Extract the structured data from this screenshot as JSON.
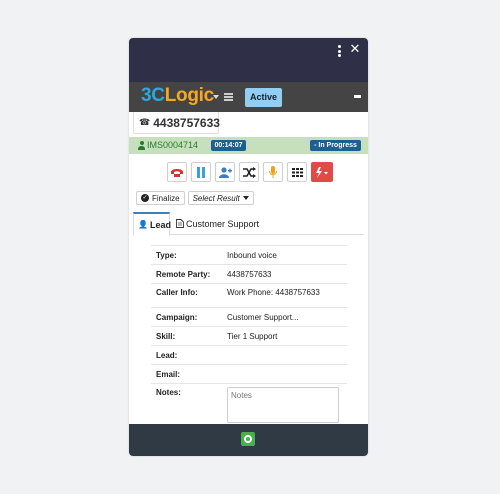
{
  "window": {
    "menu_icon": "kebab-menu-icon",
    "close_icon": "close-icon",
    "close_glyph": "✕"
  },
  "brand": {
    "logo_part1": "3C",
    "logo_part2": "Logic",
    "status_button": "Active"
  },
  "call": {
    "phone_number": "4438757633",
    "interaction_id": "IMS0004714",
    "timer": "00:14:07",
    "status": "- In Progress"
  },
  "controls": {
    "finalize_label": "Finalize",
    "select_result_label": "Select Result",
    "action_icons": [
      "hangup-icon",
      "hold-icon",
      "add-party-icon",
      "transfer-icon",
      "mute-microphone-icon",
      "keypad-icon",
      "alert-dropdown-icon"
    ]
  },
  "tabs": {
    "lead": "Lead",
    "support": "Customer Support"
  },
  "details": [
    {
      "label": "Type:",
      "value": "Inbound voice"
    },
    {
      "label": "Remote Party:",
      "value": "4438757633"
    },
    {
      "label": "Caller Info:",
      "value": "Work Phone: 4438757633"
    },
    {
      "label": "Campaign:",
      "value": "Customer Support..."
    },
    {
      "label": "Skill:",
      "value": "Tier 1 Support"
    },
    {
      "label": "Lead:",
      "value": ""
    },
    {
      "label": "Email:",
      "value": ""
    },
    {
      "label": "Notes:",
      "placeholder": "Notes"
    }
  ],
  "colors": {
    "header": "#2f3048",
    "brand_bar": "#444444",
    "active": "#92cdf2",
    "call_bar": "#c6e0bd",
    "badge": "#1c5f91",
    "alert": "#e04b47",
    "footer": "#2f3a44",
    "footer_button": "#4cae4c"
  }
}
